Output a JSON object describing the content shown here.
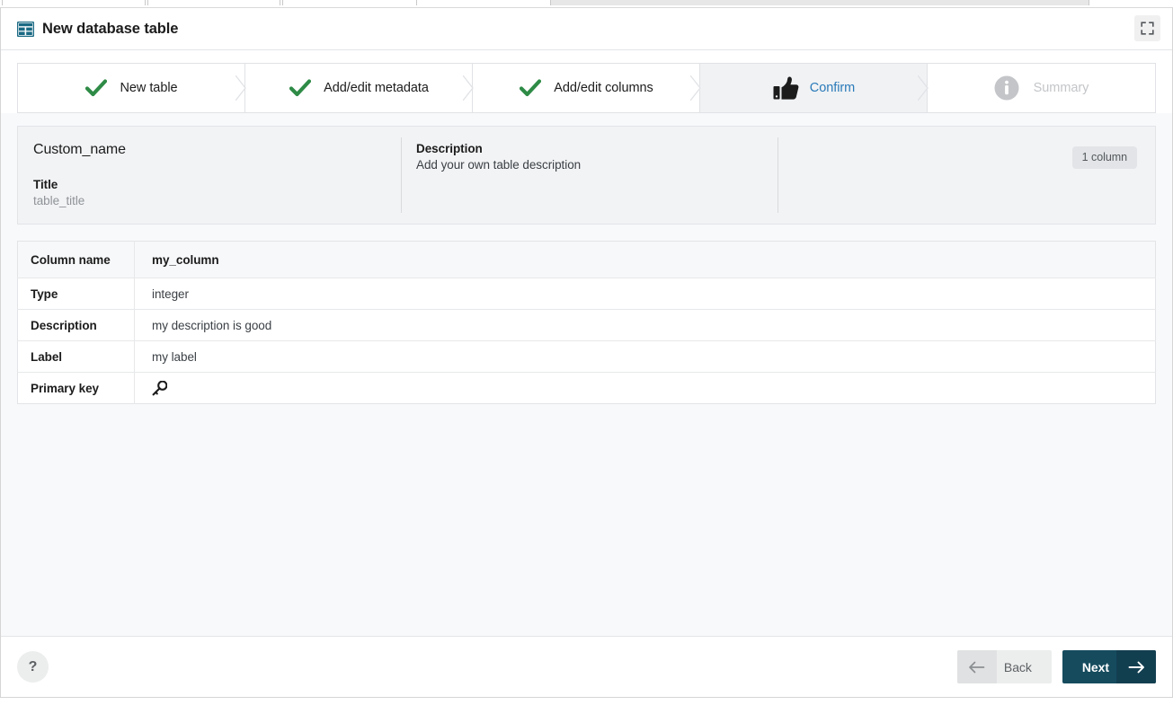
{
  "window": {
    "title": "New database table",
    "title_icon": "table-grid-icon",
    "expand_icon": "expand-fullscreen-icon",
    "accent_color": "#1b6a84",
    "active_step_color": "#2b7bb9",
    "check_color": "#2e8b46"
  },
  "stepper": {
    "steps": [
      {
        "label": "New table",
        "state": "done",
        "icon": "check-icon"
      },
      {
        "label": "Add/edit metadata",
        "state": "done",
        "icon": "check-icon"
      },
      {
        "label": "Add/edit columns",
        "state": "done",
        "icon": "check-icon"
      },
      {
        "label": "Confirm",
        "state": "active",
        "icon": "thumbs-up-icon"
      },
      {
        "label": "Summary",
        "state": "disabled",
        "icon": "info-circle-icon"
      }
    ]
  },
  "summary": {
    "table_name": "Custom_name",
    "title_label": "Title",
    "title_value": "table_title",
    "description_label": "Description",
    "description_value": "Add your own table description",
    "column_count_badge": "1 column"
  },
  "detail": {
    "rows": [
      {
        "label": "Column name",
        "value": "my_column",
        "emphasis": true,
        "icon": null
      },
      {
        "label": "Type",
        "value": "integer",
        "emphasis": false,
        "icon": null
      },
      {
        "label": "Description",
        "value": "my description is good",
        "emphasis": false,
        "icon": null
      },
      {
        "label": "Label",
        "value": "my label",
        "emphasis": false,
        "icon": null
      },
      {
        "label": "Primary key",
        "value": "",
        "emphasis": false,
        "icon": "key-icon"
      }
    ]
  },
  "footer": {
    "help_label": "?",
    "back_label": "Back",
    "next_label": "Next",
    "back_icon": "arrow-left-icon",
    "next_icon": "arrow-right-icon"
  }
}
